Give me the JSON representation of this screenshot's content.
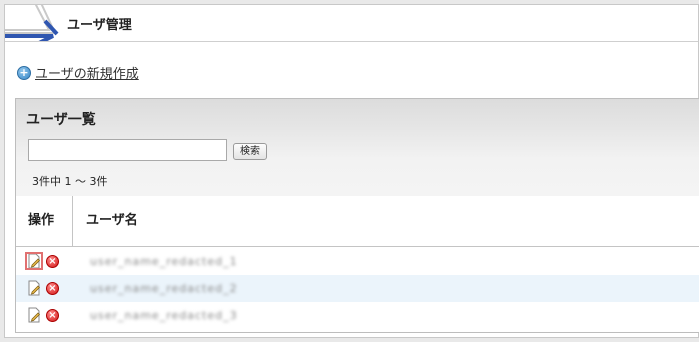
{
  "header": {
    "title": "ユーザ管理"
  },
  "actions": {
    "new_user_label": "ユーザの新規作成",
    "new_user_icon": "plus-circle-icon"
  },
  "user_list": {
    "title": "ユーザ一覧",
    "search": {
      "value": "",
      "placeholder": "",
      "button_label": "検索"
    },
    "count_text": "3件中 1 〜 3件",
    "columns": {
      "operations": "操作",
      "username": "ユーザ名"
    },
    "rows": [
      {
        "username": "user_name_redacted_1",
        "edit_icon": "edit-icon",
        "delete_icon": "delete-icon"
      },
      {
        "username": "user_name_redacted_2",
        "edit_icon": "edit-icon",
        "delete_icon": "delete-icon"
      },
      {
        "username": "user_name_redacted_3",
        "edit_icon": "edit-icon",
        "delete_icon": "delete-icon"
      }
    ]
  },
  "colors": {
    "accent_blue": "#2f56b0",
    "row_alt": "#ebf4fb",
    "delete_red": "#d31818"
  }
}
